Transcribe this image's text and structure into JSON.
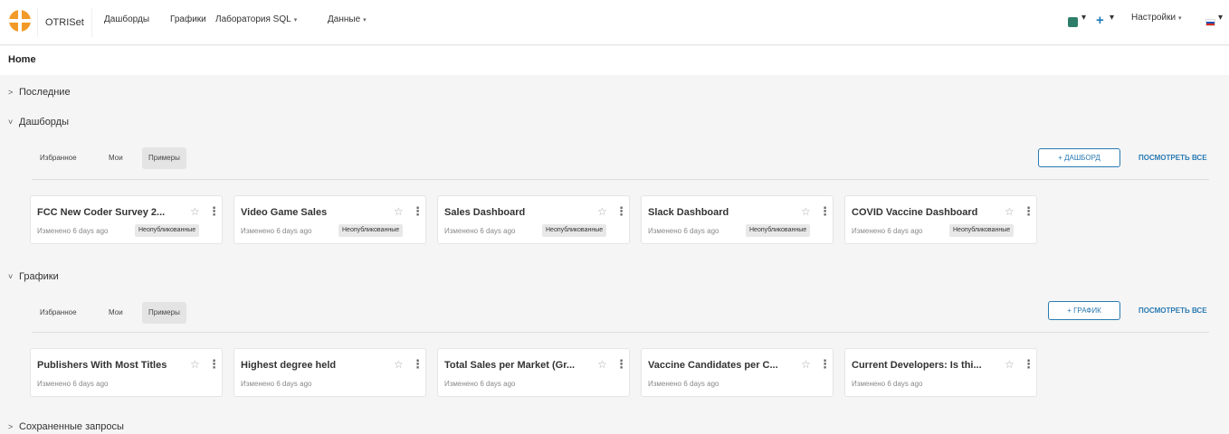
{
  "nav": {
    "brand": "OTRISet",
    "items": [
      {
        "label": "Дашборды",
        "caret": ""
      },
      {
        "label": "Графики",
        "caret": ""
      },
      {
        "label": "Лаборатория SQL",
        "caret": "▾"
      },
      {
        "label": "Данные",
        "caret": "▾"
      }
    ],
    "right": {
      "settings_label": "Настройки",
      "sql_caret": "▾",
      "plus_caret": "▾",
      "settings_caret": "▾",
      "flag_caret": "▾"
    },
    "icons": [
      "logo-icon",
      "sql-lab-icon",
      "plus-icon",
      "flag-ru-icon"
    ]
  },
  "page": {
    "title": "Home"
  },
  "sections": {
    "recent": {
      "label": "Последние",
      "arrow": ">"
    },
    "dashboards": {
      "label": "Дашборды",
      "arrow": "˅",
      "tabs": [
        "Избранное",
        "Мои",
        "Примеры"
      ],
      "active_tab": "Примеры",
      "add_label": "+ ДАШБОРД",
      "view_all": "ПОСМОТРЕТЬ ВСЕ",
      "cards": [
        {
          "title": "FCC New Coder Survey 2...",
          "meta": "Изменено 6 days ago",
          "badge": "Неопубликованные"
        },
        {
          "title": "Video Game Sales",
          "meta": "Изменено 6 days ago",
          "badge": "Неопубликованные"
        },
        {
          "title": "Sales Dashboard",
          "meta": "Изменено 6 days ago",
          "badge": "Неопубликованные"
        },
        {
          "title": "Slack Dashboard",
          "meta": "Изменено 6 days ago",
          "badge": "Неопубликованные"
        },
        {
          "title": "COVID Vaccine Dashboard",
          "meta": "Изменено 6 days ago",
          "badge": "Неопубликованные"
        }
      ]
    },
    "charts": {
      "label": "Графики",
      "arrow": "˅",
      "tabs": [
        "Избранное",
        "Мои",
        "Примеры"
      ],
      "active_tab": "Примеры",
      "add_label": "+ ГРАФИК",
      "view_all": "ПОСМОТРЕТЬ ВСЕ",
      "cards": [
        {
          "title": "Publishers With Most Titles",
          "meta": "Изменено 6 days ago"
        },
        {
          "title": "Highest degree held",
          "meta": "Изменено 6 days ago"
        },
        {
          "title": "Total Sales per Market (Gr...",
          "meta": "Изменено 6 days ago"
        },
        {
          "title": "Vaccine Candidates per C...",
          "meta": "Изменено 6 days ago"
        },
        {
          "title": "Current Developers: Is thi...",
          "meta": "Изменено 6 days ago"
        }
      ]
    },
    "saved_queries": {
      "label": "Сохраненные запросы",
      "arrow": ">"
    }
  },
  "colors": {
    "accent": "#2a7ab2",
    "logo": "#f29a29",
    "sql_icon": "#2e7d6a"
  },
  "card_icons": {
    "star": "☆",
    "menu": "⋮"
  }
}
